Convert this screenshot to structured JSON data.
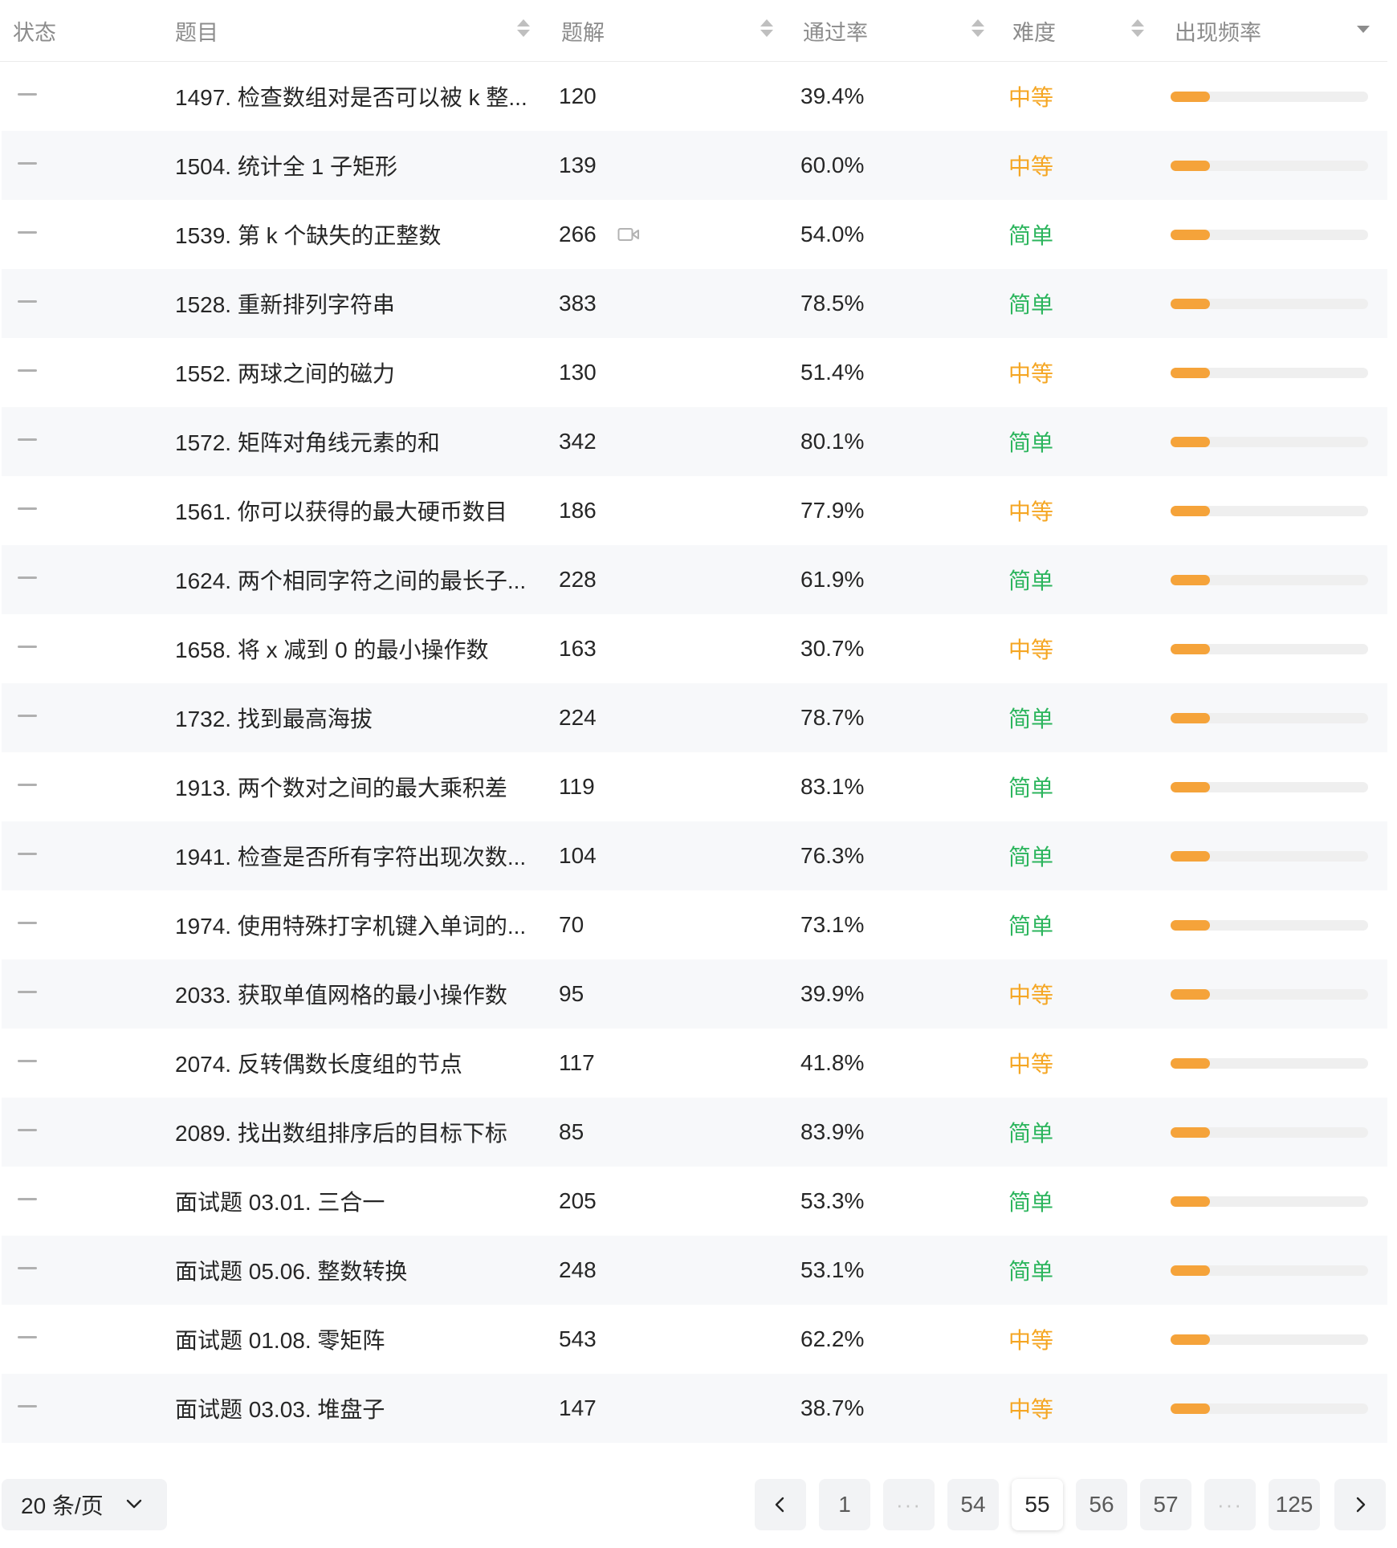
{
  "header": {
    "status": "状态",
    "title": "题目",
    "solutions": "题解",
    "acceptance": "通过率",
    "difficulty": "难度",
    "frequency": "出现频率"
  },
  "rows": [
    {
      "title": "1497. 检查数组对是否可以被 k 整...",
      "solutions": "120",
      "acceptance": "39.4%",
      "difficulty": "中等",
      "level": "medium",
      "frequency": 0.2
    },
    {
      "title": "1504. 统计全 1 子矩形",
      "solutions": "139",
      "acceptance": "60.0%",
      "difficulty": "中等",
      "level": "medium",
      "frequency": 0.2
    },
    {
      "title": "1539. 第 k 个缺失的正整数",
      "solutions": "266",
      "acceptance": "54.0%",
      "difficulty": "简单",
      "level": "easy",
      "frequency": 0.2,
      "video": true
    },
    {
      "title": "1528. 重新排列字符串",
      "solutions": "383",
      "acceptance": "78.5%",
      "difficulty": "简单",
      "level": "easy",
      "frequency": 0.2
    },
    {
      "title": "1552. 两球之间的磁力",
      "solutions": "130",
      "acceptance": "51.4%",
      "difficulty": "中等",
      "level": "medium",
      "frequency": 0.2
    },
    {
      "title": "1572. 矩阵对角线元素的和",
      "solutions": "342",
      "acceptance": "80.1%",
      "difficulty": "简单",
      "level": "easy",
      "frequency": 0.2
    },
    {
      "title": "1561. 你可以获得的最大硬币数目",
      "solutions": "186",
      "acceptance": "77.9%",
      "difficulty": "中等",
      "level": "medium",
      "frequency": 0.2
    },
    {
      "title": "1624. 两个相同字符之间的最长子...",
      "solutions": "228",
      "acceptance": "61.9%",
      "difficulty": "简单",
      "level": "easy",
      "frequency": 0.2
    },
    {
      "title": "1658. 将 x 减到 0 的最小操作数",
      "solutions": "163",
      "acceptance": "30.7%",
      "difficulty": "中等",
      "level": "medium",
      "frequency": 0.2
    },
    {
      "title": "1732. 找到最高海拔",
      "solutions": "224",
      "acceptance": "78.7%",
      "difficulty": "简单",
      "level": "easy",
      "frequency": 0.2
    },
    {
      "title": "1913. 两个数对之间的最大乘积差",
      "solutions": "119",
      "acceptance": "83.1%",
      "difficulty": "简单",
      "level": "easy",
      "frequency": 0.2
    },
    {
      "title": "1941. 检查是否所有字符出现次数...",
      "solutions": "104",
      "acceptance": "76.3%",
      "difficulty": "简单",
      "level": "easy",
      "frequency": 0.2
    },
    {
      "title": "1974. 使用特殊打字机键入单词的...",
      "solutions": "70",
      "acceptance": "73.1%",
      "difficulty": "简单",
      "level": "easy",
      "frequency": 0.2
    },
    {
      "title": "2033. 获取单值网格的最小操作数",
      "solutions": "95",
      "acceptance": "39.9%",
      "difficulty": "中等",
      "level": "medium",
      "frequency": 0.2
    },
    {
      "title": "2074. 反转偶数长度组的节点",
      "solutions": "117",
      "acceptance": "41.8%",
      "difficulty": "中等",
      "level": "medium",
      "frequency": 0.2
    },
    {
      "title": "2089. 找出数组排序后的目标下标",
      "solutions": "85",
      "acceptance": "83.9%",
      "difficulty": "简单",
      "level": "easy",
      "frequency": 0.2
    },
    {
      "title": "面试题 03.01. 三合一",
      "solutions": "205",
      "acceptance": "53.3%",
      "difficulty": "简单",
      "level": "easy",
      "frequency": 0.2
    },
    {
      "title": "面试题 05.06. 整数转换",
      "solutions": "248",
      "acceptance": "53.1%",
      "difficulty": "简单",
      "level": "easy",
      "frequency": 0.2
    },
    {
      "title": "面试题 01.08. 零矩阵",
      "solutions": "543",
      "acceptance": "62.2%",
      "difficulty": "中等",
      "level": "medium",
      "frequency": 0.2
    },
    {
      "title": "面试题 03.03. 堆盘子",
      "solutions": "147",
      "acceptance": "38.7%",
      "difficulty": "中等",
      "level": "medium",
      "frequency": 0.2
    }
  ],
  "pagination": {
    "page_size_label": "20 条/页",
    "pages": [
      "1",
      "···",
      "54",
      "55",
      "56",
      "57",
      "···",
      "125"
    ],
    "current": "55"
  },
  "colors": {
    "easy": "#2cb55d",
    "medium": "#f5a623",
    "frequency_bar": "#f5a33a",
    "frequency_track": "#efefef",
    "row_alt": "#f7f8fa"
  },
  "icons": {
    "sort": "sort-icon",
    "column_menu": "chevron-down-icon",
    "status": "dash-icon",
    "video": "video-icon",
    "prev": "chevron-left-icon",
    "next": "chevron-right-icon"
  }
}
